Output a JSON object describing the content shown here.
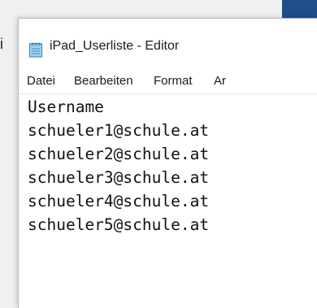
{
  "window": {
    "title": "iPad_Userliste - Editor",
    "icon": "notepad-icon",
    "background_fragment": "i"
  },
  "menu": [
    {
      "label": "Datei"
    },
    {
      "label": "Bearbeiten"
    },
    {
      "label": "Format"
    },
    {
      "label": "Ar"
    }
  ],
  "document": {
    "lines": [
      "Username",
      "schueler1@schule.at",
      "schueler2@schule.at",
      "schueler3@schule.at",
      "schueler4@schule.at",
      "schueler5@schule.at"
    ]
  },
  "colors": {
    "accent": "#1f4e8c",
    "window_bg": "#ffffff",
    "desktop_bg": "#f0f0f0"
  }
}
